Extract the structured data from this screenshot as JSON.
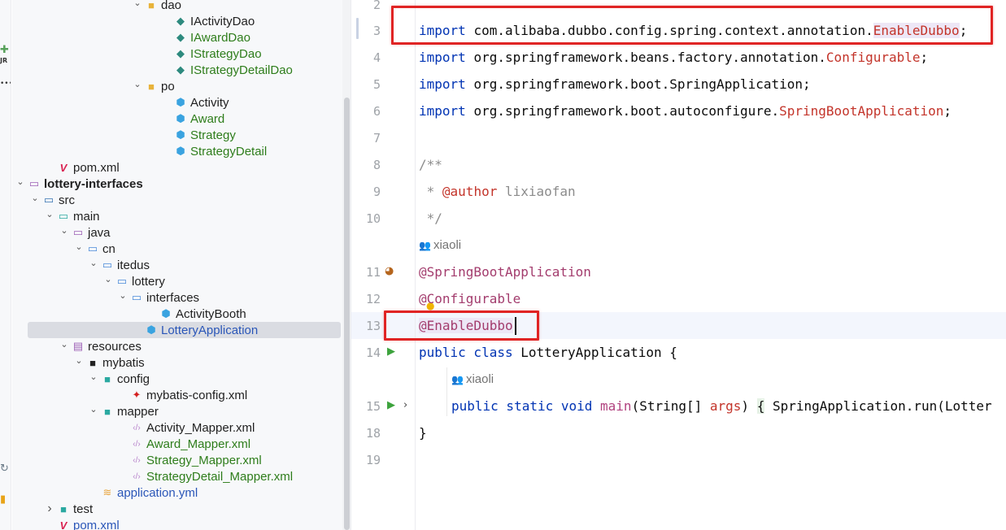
{
  "strip": {
    "icons": [
      "plugin-icon",
      "more-icon",
      "sync-icon",
      "notes-icon"
    ],
    "plugin_label": "JR",
    "more_label": "•••"
  },
  "tree": {
    "rows": [
      {
        "label": "dao",
        "indent": 9,
        "type": "folder-open",
        "arrow": "open"
      },
      {
        "label": "IActivityDao",
        "indent": 11,
        "type": "java-interface"
      },
      {
        "label": "IAwardDao",
        "indent": 11,
        "type": "java-interface",
        "color": "green"
      },
      {
        "label": "IStrategyDao",
        "indent": 11,
        "type": "java-interface",
        "color": "green"
      },
      {
        "label": "IStrategyDetailDao",
        "indent": 11,
        "type": "java-interface",
        "color": "green"
      },
      {
        "label": "po",
        "indent": 9,
        "type": "folder-open",
        "arrow": "open"
      },
      {
        "label": "Activity",
        "indent": 11,
        "type": "java-class"
      },
      {
        "label": "Award",
        "indent": 11,
        "type": "java-class",
        "color": "green"
      },
      {
        "label": "Strategy",
        "indent": 11,
        "type": "java-class",
        "color": "green"
      },
      {
        "label": "StrategyDetail",
        "indent": 11,
        "type": "java-class",
        "color": "green"
      },
      {
        "label": "pom.xml",
        "indent": 3,
        "type": "maven"
      },
      {
        "label": "lottery-interfaces",
        "indent": 1,
        "type": "module",
        "arrow": "open",
        "bold": true
      },
      {
        "label": "src",
        "indent": 2,
        "type": "folder-src",
        "arrow": "open"
      },
      {
        "label": "main",
        "indent": 3,
        "type": "folder-main",
        "arrow": "open"
      },
      {
        "label": "java",
        "indent": 4,
        "type": "folder-java",
        "arrow": "open"
      },
      {
        "label": "cn",
        "indent": 5,
        "type": "package",
        "arrow": "open"
      },
      {
        "label": "itedus",
        "indent": 6,
        "type": "package",
        "arrow": "open"
      },
      {
        "label": "lottery",
        "indent": 7,
        "type": "package",
        "arrow": "open"
      },
      {
        "label": "interfaces",
        "indent": 8,
        "type": "package",
        "arrow": "open"
      },
      {
        "label": "ActivityBooth",
        "indent": 10,
        "type": "java-class"
      },
      {
        "label": "LotteryApplication",
        "indent": 9,
        "type": "java-class",
        "color": "blue",
        "selected": true
      },
      {
        "label": "resources",
        "indent": 4,
        "type": "folder-res",
        "arrow": "open"
      },
      {
        "label": "mybatis",
        "indent": 5,
        "type": "folder-dark",
        "arrow": "open"
      },
      {
        "label": "config",
        "indent": 6,
        "type": "folder-config",
        "arrow": "open"
      },
      {
        "label": "mybatis-config.xml",
        "indent": 8,
        "type": "mybatis-bird"
      },
      {
        "label": "mapper",
        "indent": 6,
        "type": "folder-mapper",
        "arrow": "open"
      },
      {
        "label": "Activity_Mapper.xml",
        "indent": 8,
        "type": "xml"
      },
      {
        "label": "Award_Mapper.xml",
        "indent": 8,
        "type": "xml",
        "color": "green"
      },
      {
        "label": "Strategy_Mapper.xml",
        "indent": 8,
        "type": "xml",
        "color": "green"
      },
      {
        "label": "StrategyDetail_Mapper.xml",
        "indent": 8,
        "type": "xml",
        "color": "green"
      },
      {
        "label": "application.yml",
        "indent": 6,
        "type": "yml",
        "color": "blue"
      },
      {
        "label": "test",
        "indent": 3,
        "type": "folder-test",
        "arrow": "closed"
      },
      {
        "label": "pom.xml",
        "indent": 3,
        "type": "maven",
        "color": "blue"
      }
    ]
  },
  "editor": {
    "line_numbers": [
      "2",
      "3",
      "4",
      "5",
      "6",
      "7",
      "8",
      "9",
      "10",
      "11",
      "12",
      "13",
      "14",
      "15",
      "18",
      "19"
    ],
    "import_kw": "import",
    "imports": [
      {
        "pkg": "com.alibaba.dubbo.config.spring.context.annotation.",
        "cls": "EnableDubbo",
        "end": ";"
      },
      {
        "pkg": "org.springframework.beans.factory.annotation.",
        "cls": "Configurable",
        "end": ";"
      },
      {
        "pkg": "org.springframework.boot.SpringApplication;",
        "cls": "",
        "end": ""
      },
      {
        "pkg": "org.springframework.boot.autoconfigure.",
        "cls": "SpringBootApplication",
        "end": ";"
      }
    ],
    "doc_open": "/**",
    "doc_star": " * ",
    "doc_tag": "@author",
    "doc_author": " lixiaofan",
    "doc_close": " */",
    "inlay_author": "xiaoli",
    "ann_springboot": "@SpringBootApplication",
    "ann_configurable": "@Configurable",
    "ann_enabledubbo": "@EnableDubbo",
    "class_kw": "public class ",
    "class_name": "LotteryApplication",
    "class_open": " {",
    "method_kw": "public static void ",
    "method_name": "main",
    "method_params_pre": "(String[] ",
    "method_param": "args",
    "method_params_post": ") ",
    "method_brace": "{",
    "method_body": " SpringApplication.run(Lotter",
    "class_close": "}"
  }
}
